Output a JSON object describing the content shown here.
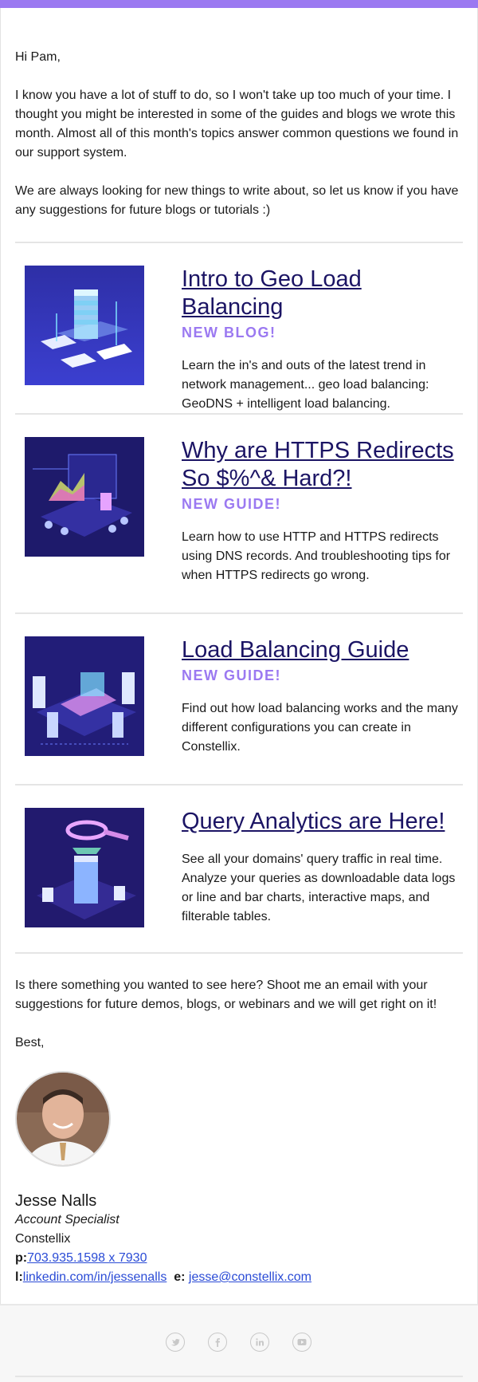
{
  "colors": {
    "accent": "#9b79f1",
    "title_link": "#1b1464",
    "link": "#2a4bd6"
  },
  "greeting": "Hi Pam,",
  "intro_paragraphs": [
    "I know you have a lot of stuff to do, so I won't take up too much of your time. I thought you might be interested in some of the guides and blogs we wrote this month. Almost all of this month's topics answer common questions we found in our support system.",
    "We are always looking for new things to write about, so let us know if you have any suggestions for future blogs or tutorials :)"
  ],
  "cards": [
    {
      "title": "Intro to Geo Load Balancing",
      "tag": "NEW BLOG!",
      "description": "Learn the in's and outs of the latest trend in network management... geo load balancing: GeoDNS + intelligent load balancing.",
      "image_icon": "server-devices-illustration"
    },
    {
      "title": "Why are HTTPS Redirects So $%^& Hard?!",
      "tag": "NEW GUIDE!",
      "description": "Learn how to use HTTP and HTTPS redirects using DNS records. And troubleshooting tips for when HTTPS redirects go wrong.",
      "image_icon": "laptop-charts-illustration"
    },
    {
      "title": "Load Balancing Guide",
      "tag": "NEW GUIDE!",
      "description": "Find out how load balancing works and the many different configurations you can create in Constellix.",
      "image_icon": "network-servers-illustration"
    },
    {
      "title": "Query Analytics are Here!",
      "tag": "",
      "description": "See all your domains' query traffic in real time. Analyze your queries as downloadable data logs or line and bar charts, interactive maps, and filterable tables.",
      "image_icon": "magnifier-analytics-illustration"
    }
  ],
  "closing": {
    "text": "Is there something you wanted to see here? Shoot me an email with your suggestions for future demos, blogs, or webinars and we will get right on it!",
    "signoff": "Best,"
  },
  "signature": {
    "name": "Jesse Nalls",
    "title": "Account Specialist",
    "company": "Constellix",
    "phone_label": "p:",
    "phone": "703.935.1598 x 7930",
    "linkedin_label": "l:",
    "linkedin": "linkedin.com/in/jessenalls",
    "email_label": "e:",
    "email": "jesse@constellix.com"
  },
  "footer": {
    "social_icons": [
      "twitter-icon",
      "facebook-icon",
      "linkedin-icon",
      "youtube-icon"
    ]
  }
}
